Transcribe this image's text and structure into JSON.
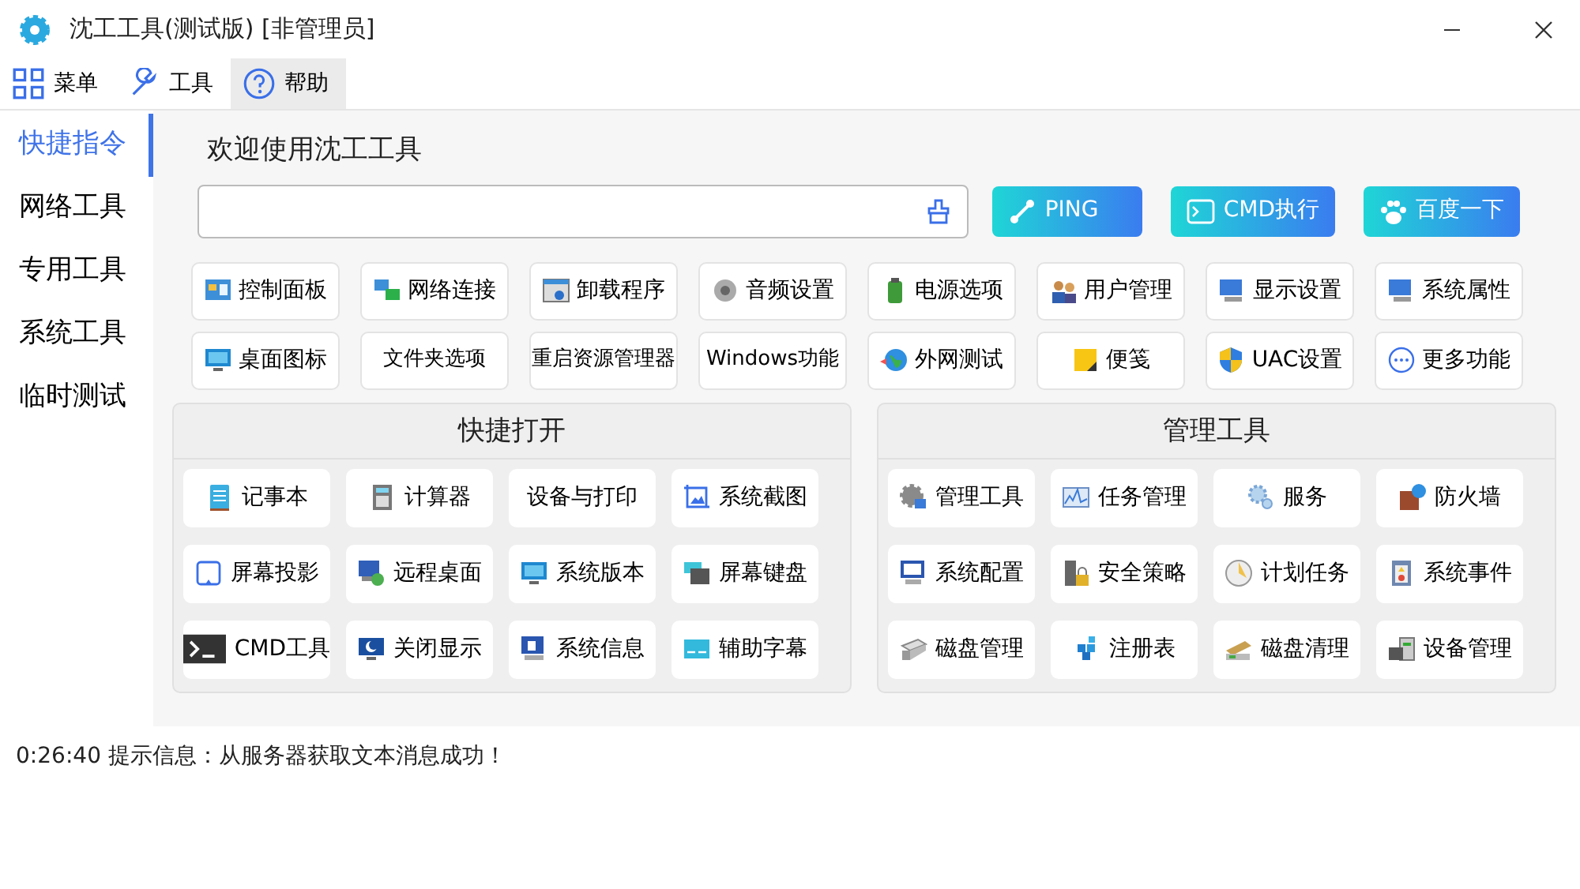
{
  "window": {
    "title": "沈工工具(测试版) [非管理员]"
  },
  "menu": [
    {
      "label": "菜单",
      "selected": false
    },
    {
      "label": "工具",
      "selected": false
    },
    {
      "label": "帮助",
      "selected": true
    }
  ],
  "sidebar": {
    "items": [
      {
        "label": "快捷指令",
        "selected": true
      },
      {
        "label": "网络工具",
        "selected": false
      },
      {
        "label": "专用工具",
        "selected": false
      },
      {
        "label": "系统工具",
        "selected": false
      },
      {
        "label": "临时测试",
        "selected": false
      }
    ]
  },
  "heading": "欢迎使用沈工工具",
  "action_buttons": [
    "PING",
    "CMD执行",
    "百度一下"
  ],
  "quick_commands": [
    "控制面板",
    "网络连接",
    "卸载程序",
    "音频设置",
    "电源选项",
    "用户管理",
    "显示设置",
    "系统属性",
    "桌面图标",
    "文件夹选项",
    "重启资源管理器",
    "Windows功能",
    "外网测试",
    "便笺",
    "UAC设置",
    "更多功能"
  ],
  "panels": [
    {
      "title": "快捷打开",
      "items": [
        "记事本",
        "计算器",
        "设备与打印",
        "系统截图",
        "屏幕投影",
        "远程桌面",
        "系统版本",
        "屏幕键盘",
        "CMD工具",
        "关闭显示",
        "系统信息",
        "辅助字幕"
      ]
    },
    {
      "title": "管理工具",
      "items": [
        "管理工具",
        "任务管理",
        "服务",
        "防火墙",
        "系统配置",
        "安全策略",
        "计划任务",
        "系统事件",
        "磁盘管理",
        "注册表",
        "磁盘清理",
        "设备管理"
      ]
    }
  ],
  "status_bar": "0:26:40 提示信息：从服务器获取文本消息成功！"
}
